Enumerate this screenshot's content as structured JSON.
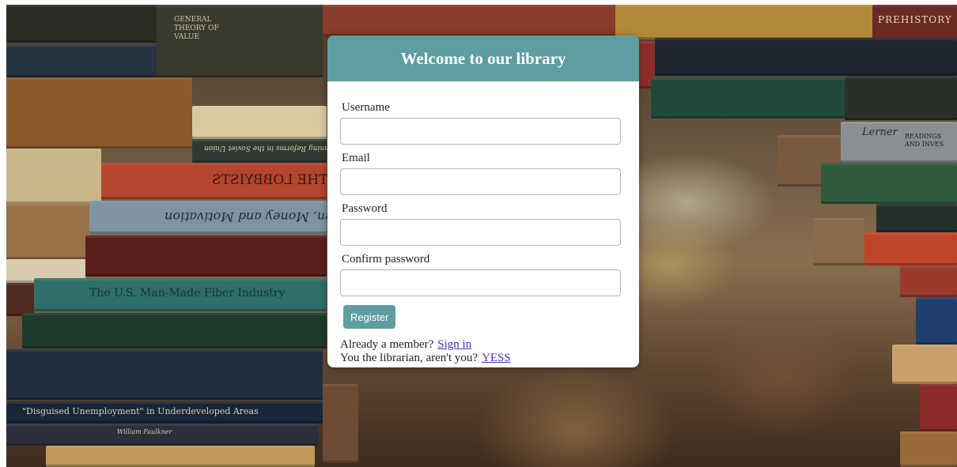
{
  "card": {
    "title": "Welcome to our library"
  },
  "form": {
    "fields": [
      {
        "label": "Username",
        "value": "",
        "placeholder": ""
      },
      {
        "label": "Email",
        "value": "",
        "placeholder": ""
      },
      {
        "label": "Password",
        "value": "",
        "placeholder": ""
      },
      {
        "label": "Confirm password",
        "value": "",
        "placeholder": ""
      }
    ],
    "submit_label": "Register"
  },
  "footer": {
    "member_prompt": "Already a member?",
    "member_link": "Sign in",
    "librarian_prompt": "You the librarian, aren't you?",
    "librarian_link": "YESS"
  },
  "background": {
    "spine_texts": [
      "PREHISTORY",
      "Lerner",
      "READINGS AND INVES",
      "THE LOBBYISTS",
      "Men, Money and Motivation",
      "The U.S. Man-Made Fiber Industry",
      "\"Disguised Unemployment\" in Underdeveloped Areas",
      "William Faulkner",
      "GENERAL THEORY OF VALUE",
      "Planning Reforms in the Soviet Union"
    ]
  },
  "colors": {
    "accent": "#5f9ea0",
    "link": "#4a2db5"
  }
}
